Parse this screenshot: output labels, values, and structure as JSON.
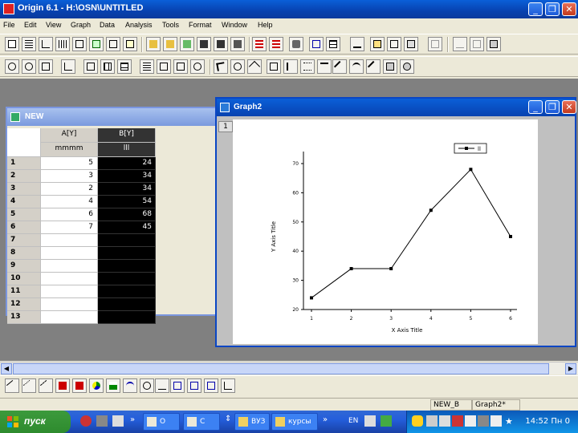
{
  "app": {
    "title": "Origin 6.1 - H:\\OSN\\UNTITLED",
    "controls": {
      "minimize": "_",
      "restore": "❐",
      "close": "✕"
    }
  },
  "menu": [
    "File",
    "Edit",
    "View",
    "Graph",
    "Data",
    "Analysis",
    "Tools",
    "Format",
    "Window",
    "Help"
  ],
  "worksheet": {
    "title": "NEW",
    "columns": [
      {
        "name": "A[Y]",
        "label": "mmmm"
      },
      {
        "name": "B[Y]",
        "label": "lll"
      }
    ],
    "rows": [
      {
        "n": "1",
        "a": "5",
        "b": "24"
      },
      {
        "n": "2",
        "a": "3",
        "b": "34"
      },
      {
        "n": "3",
        "a": "2",
        "b": "34"
      },
      {
        "n": "4",
        "a": "4",
        "b": "54"
      },
      {
        "n": "5",
        "a": "6",
        "b": "68"
      },
      {
        "n": "6",
        "a": "7",
        "b": "45"
      },
      {
        "n": "7",
        "a": "",
        "b": ""
      },
      {
        "n": "8",
        "a": "",
        "b": ""
      },
      {
        "n": "9",
        "a": "",
        "b": ""
      },
      {
        "n": "10",
        "a": "",
        "b": ""
      },
      {
        "n": "11",
        "a": "",
        "b": ""
      },
      {
        "n": "12",
        "a": "",
        "b": ""
      },
      {
        "n": "13",
        "a": "",
        "b": ""
      }
    ]
  },
  "graph": {
    "title": "Graph2",
    "layer": "1",
    "legend": "ll"
  },
  "chart_data": {
    "type": "line",
    "x": [
      1,
      2,
      3,
      4,
      5,
      6
    ],
    "series": [
      {
        "name": "ll",
        "values": [
          24,
          34,
          34,
          54,
          68,
          45
        ]
      }
    ],
    "xlabel": "X Axis Title",
    "ylabel": "Y Axis Title",
    "xlim": [
      1,
      6
    ],
    "ylim": [
      20,
      70
    ],
    "xticks": [
      "1",
      "2",
      "3",
      "4",
      "5",
      "6"
    ],
    "yticks": [
      "20",
      "30",
      "40",
      "50",
      "60",
      "70"
    ],
    "grid": false,
    "legend_position": "top-right"
  },
  "status": {
    "pane1": "NEW_B",
    "pane2": "Graph2*"
  },
  "taskbar": {
    "start_label": "пуск",
    "items": [
      "O",
      "C",
      "ВУЗ",
      "курсы"
    ],
    "lang": "EN",
    "clock": "14:52 Пн 0"
  }
}
